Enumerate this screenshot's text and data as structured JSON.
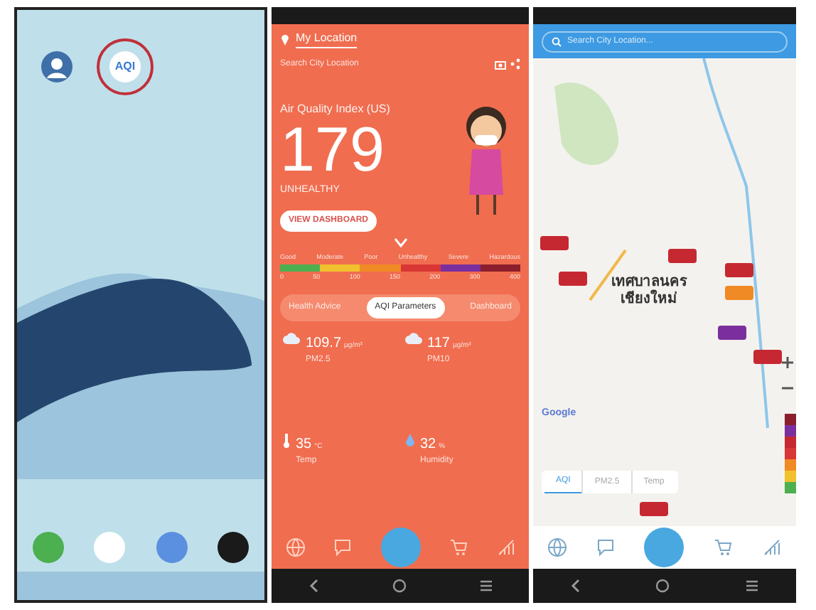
{
  "home_screen": {
    "apps": [
      {
        "kind": "person",
        "highlighted": false
      },
      {
        "kind": "aqi",
        "highlighted": true,
        "icon_text": "AQI"
      }
    ],
    "dock": [
      {
        "kind": "phone"
      },
      {
        "kind": "compass"
      },
      {
        "kind": "messages"
      },
      {
        "kind": "camera"
      }
    ]
  },
  "aqi_screen": {
    "tabs": [
      {
        "label": "My Location",
        "selected": true
      }
    ],
    "search": {
      "placeholder": "Search City Location"
    },
    "index_label": "Air Quality Index (US)",
    "aqi_value": "179",
    "status": "UNHEALTHY",
    "dashboard_button": "VIEW DASHBOARD",
    "scale_labels": [
      "Good",
      "Moderate",
      "Poor",
      "Unhealthy",
      "Severe",
      "Hazardous"
    ],
    "scale_segments": [
      {
        "color": "#4caf50"
      },
      {
        "color": "#f2c12e"
      },
      {
        "color": "#f08a24"
      },
      {
        "color": "#d93636"
      },
      {
        "color": "#7b2f9e"
      },
      {
        "color": "#8b1e2d"
      }
    ],
    "scale_ticks": [
      "0",
      "50",
      "100",
      "150",
      "200",
      "300",
      "400"
    ],
    "segments": [
      {
        "label": "Health Advice",
        "selected": false
      },
      {
        "label": "AQI Parameters",
        "selected": true
      },
      {
        "label": "Dashboard",
        "selected": false
      }
    ],
    "parameters": [
      {
        "kind": "cloud",
        "value": "109.7",
        "unit": "µg/m³",
        "name": "PM2.5"
      },
      {
        "kind": "cloud",
        "value": "117",
        "unit": "µg/m³",
        "name": "PM10"
      },
      {
        "kind": "thermometer",
        "value": "35",
        "unit": "°C",
        "name": "Temp"
      },
      {
        "kind": "drop",
        "value": "32",
        "unit": "%",
        "name": "Humidity"
      }
    ]
  },
  "map_screen": {
    "search": {
      "placeholder": "Search City Location..."
    },
    "city_label": [
      "เทศบาลนคร",
      "เชียงใหม่"
    ],
    "map_credit": "Google",
    "markers": [
      {
        "color": "#c62832"
      },
      {
        "color": "#c62832"
      },
      {
        "color": "#c62832"
      },
      {
        "color": "#f08a24"
      },
      {
        "color": "#7b2f9e"
      },
      {
        "color": "#c62832"
      },
      {
        "color": "#c62832"
      },
      {
        "color": "#c62832"
      }
    ],
    "legend": [
      {
        "color": "#8b1e2d"
      },
      {
        "color": "#7b2f9e"
      },
      {
        "color": "#c62832"
      },
      {
        "color": "#d93636"
      },
      {
        "color": "#f08a24"
      },
      {
        "color": "#f2c12e"
      },
      {
        "color": "#4caf50"
      }
    ],
    "tabs": [
      {
        "label": "AQI",
        "selected": true
      },
      {
        "label": "PM2.5",
        "selected": false
      },
      {
        "label": "Temp",
        "selected": false
      }
    ]
  }
}
